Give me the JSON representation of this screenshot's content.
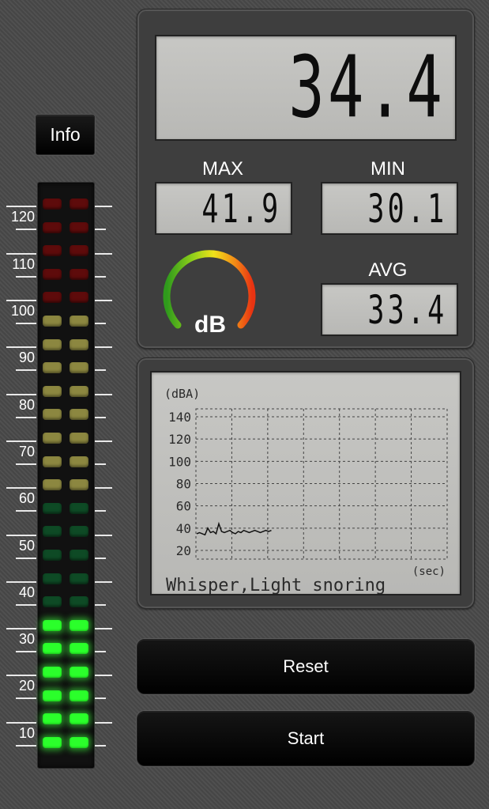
{
  "info_button": {
    "label": "Info"
  },
  "scale_labels": [
    "120",
    "110",
    "100",
    "90",
    "80",
    "70",
    "60",
    "50",
    "40",
    "30",
    "20",
    "10"
  ],
  "meter": {
    "led_rows": 24,
    "lit_rows": 6,
    "colors": {
      "red_off": "#5e0b0b",
      "yellow_off": "#8c8740",
      "green_off": "#0e4a25",
      "green_on": "#2bff2b"
    }
  },
  "display": {
    "current": "34.4",
    "max_label": "MAX",
    "max": "41.9",
    "min_label": "MIN",
    "min": "30.1",
    "avg_label": "AVG",
    "avg": "33.4",
    "unit": "dB"
  },
  "graph": {
    "y_unit": "(dBA)",
    "x_unit": "(sec)",
    "y_ticks": [
      "140",
      "120",
      "100",
      "80",
      "60",
      "40",
      "20"
    ],
    "caption": "Whisper,Light snoring",
    "history": [
      35,
      36,
      35,
      34,
      40,
      36,
      37,
      35,
      44,
      37,
      36,
      37,
      38,
      36,
      35,
      37,
      36,
      38,
      37,
      36,
      37,
      38,
      37,
      36,
      37,
      38,
      37,
      38
    ]
  },
  "buttons": {
    "reset": "Reset",
    "start": "Start"
  }
}
